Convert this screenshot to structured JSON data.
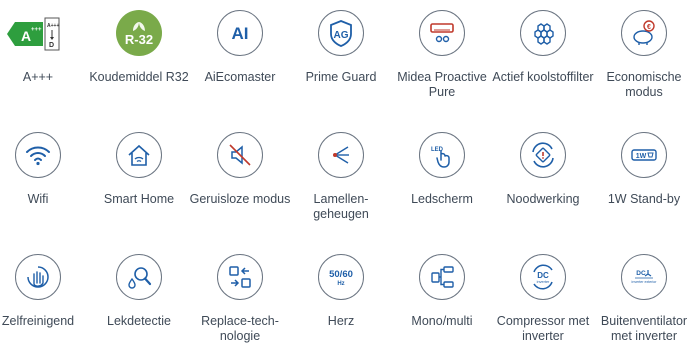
{
  "colors": {
    "icon_stroke": "#4a8fcf",
    "circle_border": "#6b7582",
    "energy_green": "#2e9e3e",
    "r32_green": "#7aaa4a",
    "text": "#3f4a57"
  },
  "energy_label": {
    "class": "A",
    "superscript": "+++",
    "scale_top": "A+++",
    "scale_bottom": "D"
  },
  "r32_badge": {
    "text": "R-32"
  },
  "badges": {
    "ai": "AI",
    "ag": "AG",
    "led": "LED",
    "hz": "50/60",
    "hz_unit": "Hz",
    "dc": "DC",
    "inverter": "inverter",
    "dc2": "DC",
    "inverter_exterior": "inverter exterior",
    "standby": "1W"
  },
  "features": [
    {
      "icon": "energy-label-icon",
      "label": "A+++"
    },
    {
      "icon": "r32-refrigerant-icon",
      "label": "Koudemiddel R32"
    },
    {
      "icon": "ai-ecomaster-icon",
      "label": "AiEcomaster"
    },
    {
      "icon": "prime-guard-shield-icon",
      "label": "Prime Guard"
    },
    {
      "icon": "air-conditioner-icon",
      "label": "Midea Proactive Pure"
    },
    {
      "icon": "carbon-filter-icon",
      "label": "Actief koolstoffilter"
    },
    {
      "icon": "piggy-bank-euro-icon",
      "label": "Economische modus"
    },
    {
      "icon": "wifi-icon",
      "label": "Wifi"
    },
    {
      "icon": "smart-home-icon",
      "label": "Smart Home"
    },
    {
      "icon": "mute-speaker-icon",
      "label": "Geruisloze modus"
    },
    {
      "icon": "louver-memory-icon",
      "label": "Lamellen-geheugen"
    },
    {
      "icon": "led-touch-icon",
      "label": "Ledscherm"
    },
    {
      "icon": "emergency-operation-icon",
      "label": "Noodwerking"
    },
    {
      "icon": "standby-1w-icon",
      "label": "1W Stand-by"
    },
    {
      "icon": "self-cleaning-hand-icon",
      "label": "Zelfreinigend"
    },
    {
      "icon": "leak-detection-icon",
      "label": "Lekdetectie"
    },
    {
      "icon": "replace-technology-icon",
      "label": "Replace-tech-nologie"
    },
    {
      "icon": "hertz-icon",
      "label": "Herz"
    },
    {
      "icon": "mono-multi-icon",
      "label": "Mono/multi"
    },
    {
      "icon": "dc-inverter-compressor-icon",
      "label": "Compressor met inverter"
    },
    {
      "icon": "outdoor-fan-inverter-icon",
      "label": "Buitenventilator met inverter"
    }
  ]
}
